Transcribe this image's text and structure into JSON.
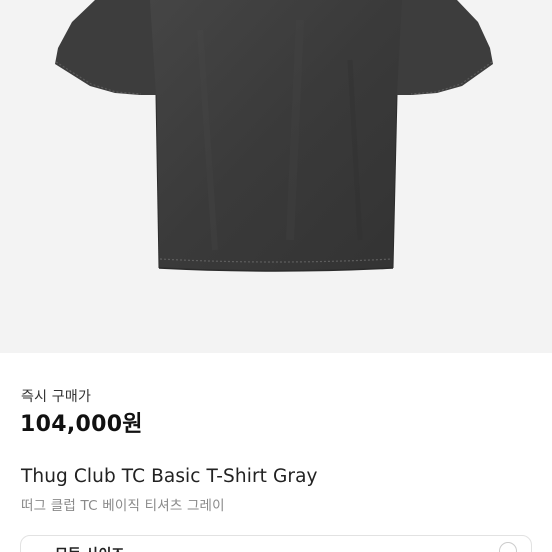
{
  "product": {
    "image_icon": "tshirt-image",
    "shirt_color": "#3a3a3a",
    "price_label": "즉시 구매가",
    "price": "104,000원",
    "title_en": "Thug Club TC Basic T-Shirt Gray",
    "title_ko": "떠그 클럽 TC 베이직 티셔츠 그레이"
  },
  "size_selector": {
    "label": "모든 사이즈",
    "icon": "chevron-down-icon"
  }
}
